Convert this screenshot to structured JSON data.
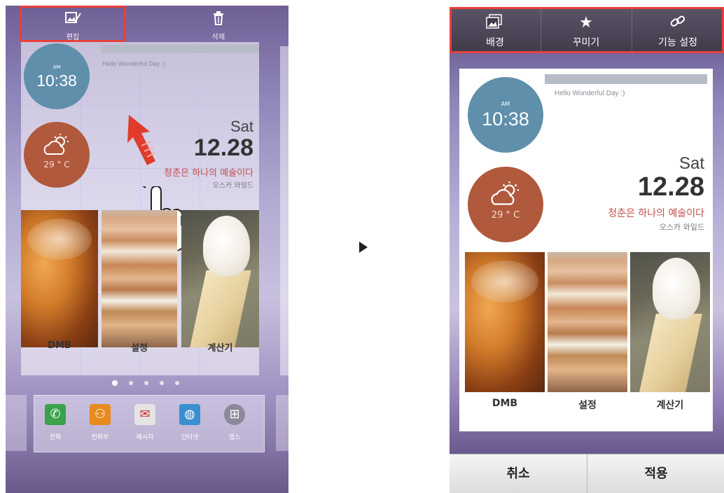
{
  "left": {
    "toolbar": {
      "edit_label": "편집",
      "delete_label": "삭제"
    },
    "widget": {
      "hello": "Hello Wonderful Day :)",
      "clock": {
        "ampm": "AM",
        "time": "10:38"
      },
      "weather": {
        "temp": "29 ° C"
      },
      "date": {
        "day": "Sat",
        "date": "12.28"
      },
      "quote": "청춘은 하나의 예술이다",
      "author": "오스카 와일드",
      "apps": [
        "DMB",
        "설정",
        "계산기"
      ]
    },
    "page_dots": {
      "count": 5,
      "active": 0
    },
    "dock": [
      {
        "label": "전화",
        "icon": "phone-icon",
        "color": "#3aa34a"
      },
      {
        "label": "전화부",
        "icon": "contacts-icon",
        "color": "#e88a1e"
      },
      {
        "label": "메시지",
        "icon": "message-icon",
        "color": "#dcdcdc"
      },
      {
        "label": "인터넷",
        "icon": "globe-icon",
        "color": "#3a8fd0"
      },
      {
        "label": "앱스",
        "icon": "apps-icon",
        "color": "#8a8a9a"
      }
    ]
  },
  "right": {
    "tabs": [
      {
        "label": "배경",
        "icon": "background-image-icon"
      },
      {
        "label": "꾸미기",
        "icon": "star-icon"
      },
      {
        "label": "기능 설정",
        "icon": "link-icon"
      }
    ],
    "widget": {
      "hello": "Hello Wonderful Day :)",
      "clock": {
        "ampm": "AM",
        "time": "10:38"
      },
      "weather": {
        "temp": "29 ° C"
      },
      "date": {
        "day": "Sat",
        "date": "12.28"
      },
      "quote": "청춘은 하나의 예술이다",
      "author": "오스카 와일드",
      "apps": [
        "DMB",
        "설정",
        "계산기"
      ]
    },
    "buttons": {
      "cancel": "취소",
      "apply": "적용"
    }
  },
  "colors": {
    "highlight": "#e8403a",
    "clock_bg": "#5f8fab",
    "weather_bg": "#b0593d",
    "quote": "#c0504d"
  }
}
